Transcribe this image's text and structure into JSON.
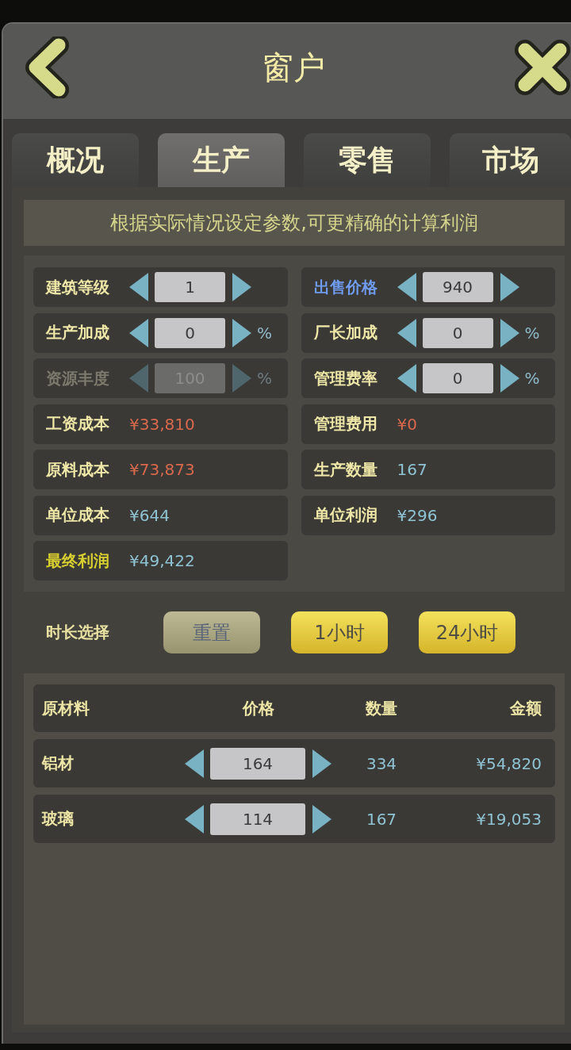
{
  "window": {
    "title": "窗户"
  },
  "tabs": [
    {
      "label": "概况",
      "selected": false
    },
    {
      "label": "生产",
      "selected": true
    },
    {
      "label": "零售",
      "selected": false
    },
    {
      "label": "市场",
      "selected": false
    }
  ],
  "hint": "根据实际情况设定参数,可更精确的计算利润",
  "params": [
    {
      "kind": "stepper",
      "label": "建筑等级",
      "color": "#efe7a8",
      "value": "1",
      "disabled": false
    },
    {
      "kind": "stepper",
      "label": "出售价格",
      "color": "#6f9cf0",
      "value": "940",
      "disabled": false
    },
    {
      "kind": "stepper",
      "label": "生产加成",
      "color": "#efe7a8",
      "value": "0",
      "unit": "%",
      "disabled": false
    },
    {
      "kind": "stepper",
      "label": "厂长加成",
      "color": "#efe7a8",
      "value": "0",
      "unit": "%",
      "disabled": false
    },
    {
      "kind": "stepper",
      "label": "资源丰度",
      "color": "#7b7a6c",
      "value": "100",
      "unit": "%",
      "disabled": true
    },
    {
      "kind": "stepper",
      "label": "管理费率",
      "color": "#efe7a8",
      "value": "0",
      "unit": "%",
      "disabled": false
    },
    {
      "kind": "readout",
      "label": "工资成本",
      "color": "#efe7a8",
      "value": {
        "text": "¥33,810",
        "color": "#d9694d"
      }
    },
    {
      "kind": "readout",
      "label": "管理费用",
      "color": "#efe7a8",
      "value": {
        "text": "¥0",
        "color": "#d9694d"
      }
    },
    {
      "kind": "readout",
      "label": "原料成本",
      "color": "#efe7a8",
      "value": {
        "text": "¥73,873",
        "color": "#d9694d"
      }
    },
    {
      "kind": "readout",
      "label": "生产数量",
      "color": "#efe7a8",
      "value": {
        "text": "167",
        "color": "#8fc3d3"
      }
    },
    {
      "kind": "readout",
      "label": "单位成本",
      "color": "#efe7a8",
      "value": {
        "text": "¥644",
        "color": "#8fc3d3"
      }
    },
    {
      "kind": "readout",
      "label": "单位利润",
      "color": "#efe7a8",
      "value": {
        "text": "¥296",
        "color": "#8fc3d3"
      }
    },
    {
      "kind": "readout",
      "label": "最终利润",
      "color": "#d8d030",
      "value": {
        "text": "¥49,422",
        "color": "#8fc3d3"
      }
    }
  ],
  "duration": {
    "label": "时长选择",
    "buttons": [
      {
        "kind": "reset",
        "label": "重置"
      },
      {
        "kind": "preset",
        "label": "1小时"
      },
      {
        "kind": "preset",
        "label": "24小时"
      }
    ]
  },
  "materials": {
    "columns": [
      "原材料",
      "价格",
      "数量",
      "金额"
    ],
    "rows": [
      {
        "name": "铝材",
        "price": "164",
        "quantity": "334",
        "amount": "¥54,820"
      },
      {
        "name": "玻璃",
        "price": "114",
        "quantity": "167",
        "amount": "¥19,053"
      }
    ]
  }
}
